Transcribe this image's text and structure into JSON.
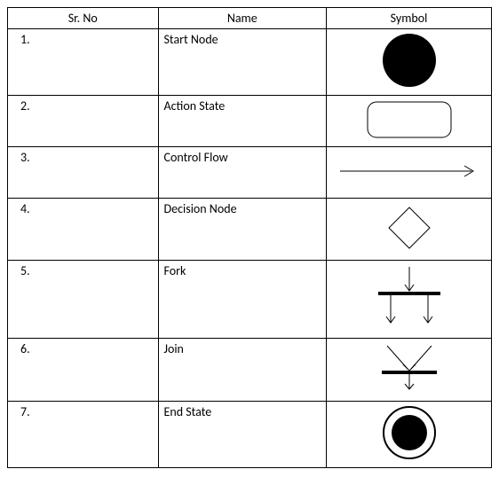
{
  "headers": {
    "sr": "Sr. No",
    "name": "Name",
    "symbol": "Symbol"
  },
  "rows": [
    {
      "sr": "1.",
      "name": "Start Node"
    },
    {
      "sr": "2.",
      "name": "Action State"
    },
    {
      "sr": "3.",
      "name": "Control Flow"
    },
    {
      "sr": "4.",
      "name": "Decision Node"
    },
    {
      "sr": "5.",
      "name": "Fork"
    },
    {
      "sr": "6.",
      "name": "Join"
    },
    {
      "sr": "7.",
      "name": "End State"
    }
  ]
}
